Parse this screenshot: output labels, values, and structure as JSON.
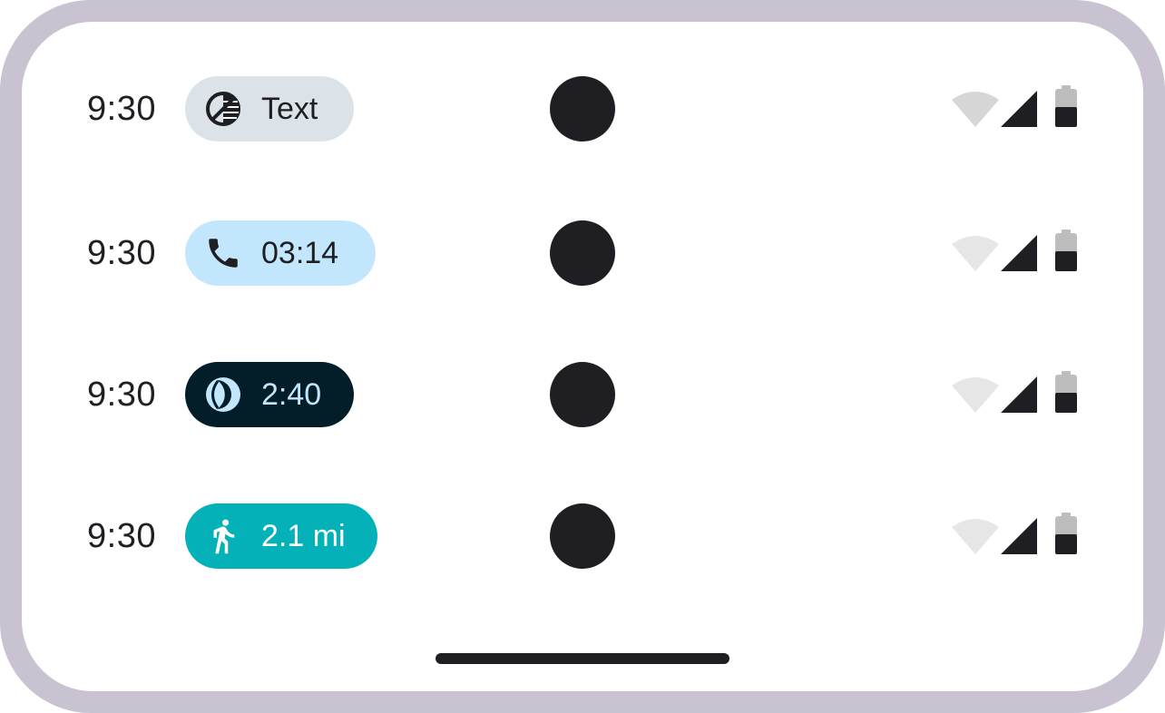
{
  "rows": [
    {
      "time": "9:30",
      "chip": {
        "label": "Text",
        "icon": "contrast-icon",
        "background": "#dbe2e8",
        "foreground": "#1f1f23"
      },
      "status": {
        "wifi_color": "#d6d6d6",
        "battery_level": 0.55
      }
    },
    {
      "time": "9:30",
      "chip": {
        "label": "03:14",
        "icon": "phone-icon",
        "background": "#c2e7fd",
        "foreground": "#1f1f23"
      },
      "status": {
        "wifi_color": "#e6e6e6",
        "battery_level": 0.55
      }
    },
    {
      "time": "9:30",
      "chip": {
        "label": "2:40",
        "icon": "moon-icon",
        "background": "#031d29",
        "foreground": "#c2e7fd"
      },
      "status": {
        "wifi_color": "#e6e6e6",
        "battery_level": 0.55
      }
    },
    {
      "time": "9:30",
      "chip": {
        "label": "2.1 mi",
        "icon": "running-icon",
        "background": "#05b1b9",
        "foreground": "#ffffff"
      },
      "status": {
        "wifi_color": "#e6e6e6",
        "battery_level": 0.55
      }
    }
  ],
  "colors": {
    "frame": "#c9c3d1",
    "screen": "#ffffff",
    "ink": "#1f1f23",
    "battery_empty": "#bdbdbd"
  }
}
